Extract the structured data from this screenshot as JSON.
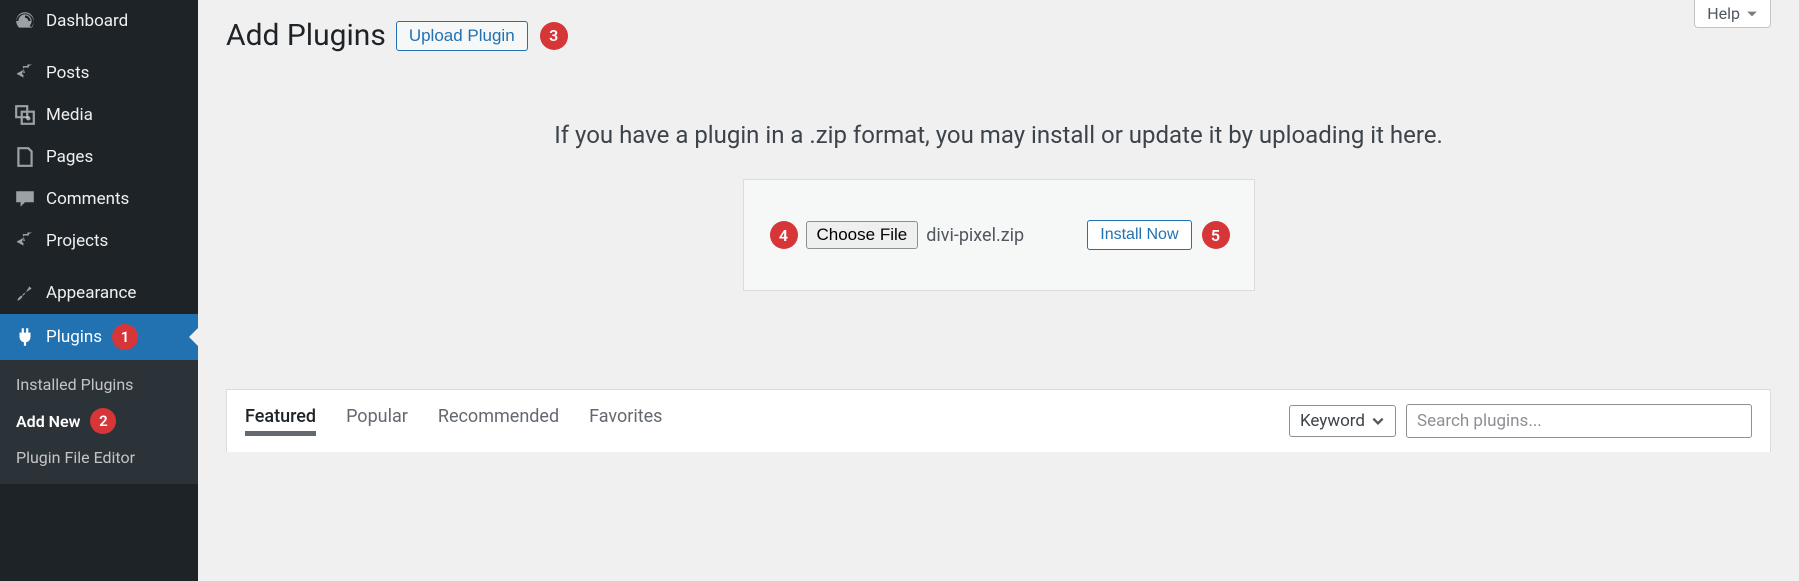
{
  "sidebar": {
    "items": [
      {
        "label": "Dashboard"
      },
      {
        "label": "Posts"
      },
      {
        "label": "Media"
      },
      {
        "label": "Pages"
      },
      {
        "label": "Comments"
      },
      {
        "label": "Projects"
      },
      {
        "label": "Appearance"
      },
      {
        "label": "Plugins"
      }
    ],
    "submenu": [
      {
        "label": "Installed Plugins"
      },
      {
        "label": "Add New"
      },
      {
        "label": "Plugin File Editor"
      }
    ]
  },
  "header": {
    "title": "Add Plugins",
    "upload_button": "Upload Plugin",
    "help": "Help"
  },
  "upload": {
    "description": "If you have a plugin in a .zip format, you may install or update it by uploading it here.",
    "choose_file": "Choose File",
    "filename": "divi-pixel.zip",
    "install_now": "Install Now"
  },
  "filter": {
    "tabs": [
      {
        "label": "Featured"
      },
      {
        "label": "Popular"
      },
      {
        "label": "Recommended"
      },
      {
        "label": "Favorites"
      }
    ],
    "keyword": "Keyword",
    "search_placeholder": "Search plugins..."
  },
  "steps": {
    "s1": "1",
    "s2": "2",
    "s3": "3",
    "s4": "4",
    "s5": "5"
  }
}
